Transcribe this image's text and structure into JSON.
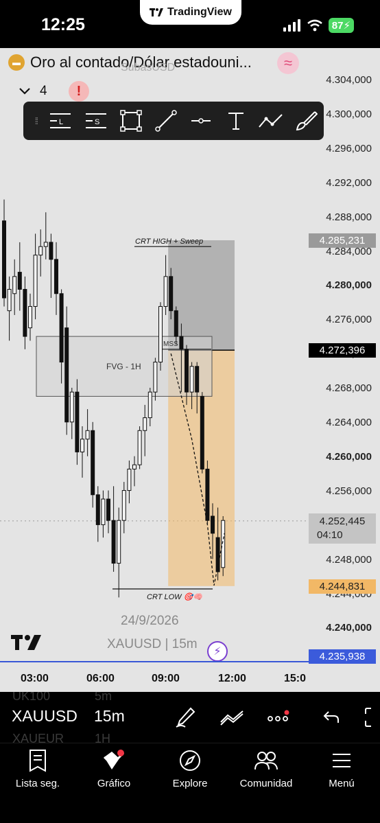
{
  "status_bar": {
    "time": "12:25",
    "app_pill": "TradingView",
    "battery": "87"
  },
  "header": {
    "symbol_title": "Oro al contado/Dólar estadouni...",
    "symbol_subtitle": "SubasUSD",
    "indicator_count": "4"
  },
  "price_axis": {
    "labels": [
      "4.304,000",
      "4.300,000",
      "4.296,000",
      "4.292,000",
      "4.288,000",
      "4.284,000",
      "4.280,000",
      "4.276,000",
      "4.272,000",
      "4.268,000",
      "4.264,000",
      "4.260,000",
      "4.256,000",
      "4.252,000",
      "4.248,000",
      "4.244,000",
      "4.240,000"
    ],
    "bold_labels": [
      "4.280,000",
      "4.260,000",
      "4.240,000"
    ]
  },
  "price_tags": {
    "upper": "4.285,231",
    "current": "4.272,396",
    "last_price": "4.252,445",
    "countdown": "04:10",
    "lower": "4.244,831",
    "blue": "4.235,938"
  },
  "annotations": {
    "crt_high": "CRT HIGH + Sweep",
    "fvg": "FVG - 1H",
    "mss": "MSS",
    "crt_low": "CRT LOW 🎯🧠"
  },
  "chart_info": {
    "date": "24/9/2026",
    "symbol_line": "XAUUSD | 15m"
  },
  "time_axis": [
    "03:00",
    "06:00",
    "09:00",
    "12:00",
    "15:0"
  ],
  "bottom_toolbar": {
    "symbol": "XAUUSD",
    "interval": "15m",
    "ghost_above_symbol": "UK100",
    "ghost_above_interval": "5m",
    "ghost_below_symbol": "XAUEUR",
    "ghost_below_interval": "1H"
  },
  "nav": [
    {
      "label": "Lista seg.",
      "icon": "watchlist-icon"
    },
    {
      "label": "Gráfico",
      "icon": "chart-icon"
    },
    {
      "label": "Explore",
      "icon": "compass-icon"
    },
    {
      "label": "Comunidad",
      "icon": "community-icon"
    },
    {
      "label": "Menú",
      "icon": "menu-icon"
    }
  ],
  "colors": {
    "background": "#e4e4e4",
    "orange_zone": "#f2b866",
    "grey_zone": "#a9a9a9",
    "blue_line": "#3857d6",
    "current_tag": "#000000",
    "lower_tag": "#f2b866",
    "blue_tag": "#3b5bdb"
  },
  "chart_data": {
    "type": "candlestick",
    "symbol": "XAUUSD",
    "interval": "15m",
    "ylim": [
      4236,
      4306
    ],
    "candles": [
      {
        "o": 4287.5,
        "h": 4290.0,
        "l": 4277.5,
        "c": 4278.5
      },
      {
        "o": 4277.0,
        "h": 4281.0,
        "l": 4273.5,
        "c": 4279.5
      },
      {
        "o": 4279.0,
        "h": 4283.0,
        "l": 4276.5,
        "c": 4281.0
      },
      {
        "o": 4281.5,
        "h": 4285.0,
        "l": 4277.0,
        "c": 4279.5
      },
      {
        "o": 4279.5,
        "h": 4281.0,
        "l": 4272.5,
        "c": 4274.0
      },
      {
        "o": 4275.0,
        "h": 4279.0,
        "l": 4273.5,
        "c": 4277.5
      },
      {
        "o": 4277.5,
        "h": 4286.0,
        "l": 4276.0,
        "c": 4283.5
      },
      {
        "o": 4283.5,
        "h": 4286.5,
        "l": 4281.0,
        "c": 4284.5
      },
      {
        "o": 4284.5,
        "h": 4288.5,
        "l": 4283.0,
        "c": 4285.0
      },
      {
        "o": 4285.0,
        "h": 4286.0,
        "l": 4278.5,
        "c": 4283.0
      },
      {
        "o": 4283.0,
        "h": 4285.0,
        "l": 4276.5,
        "c": 4279.0
      },
      {
        "o": 4279.0,
        "h": 4279.5,
        "l": 4268.5,
        "c": 4271.0
      },
      {
        "o": 4275.0,
        "h": 4277.5,
        "l": 4262.5,
        "c": 4264.0
      },
      {
        "o": 4264.0,
        "h": 4268.0,
        "l": 4262.0,
        "c": 4267.5
      },
      {
        "o": 4267.5,
        "h": 4269.0,
        "l": 4259.0,
        "c": 4260.5
      },
      {
        "o": 4260.5,
        "h": 4263.5,
        "l": 4257.5,
        "c": 4262.0
      },
      {
        "o": 4262.0,
        "h": 4265.5,
        "l": 4260.0,
        "c": 4263.0
      },
      {
        "o": 4263.0,
        "h": 4264.0,
        "l": 4254.0,
        "c": 4255.5
      },
      {
        "o": 4255.5,
        "h": 4256.5,
        "l": 4250.0,
        "c": 4252.0
      },
      {
        "o": 4252.0,
        "h": 4256.0,
        "l": 4250.5,
        "c": 4255.0
      },
      {
        "o": 4255.0,
        "h": 4256.0,
        "l": 4251.0,
        "c": 4252.5
      },
      {
        "o": 4252.5,
        "h": 4256.5,
        "l": 4246.5,
        "c": 4247.5
      },
      {
        "o": 4247.5,
        "h": 4254.0,
        "l": 4243.5,
        "c": 4252.5
      },
      {
        "o": 4252.5,
        "h": 4257.0,
        "l": 4251.0,
        "c": 4256.0
      },
      {
        "o": 4256.0,
        "h": 4259.5,
        "l": 4254.5,
        "c": 4258.5
      },
      {
        "o": 4258.5,
        "h": 4260.0,
        "l": 4256.5,
        "c": 4259.0
      },
      {
        "o": 4259.0,
        "h": 4263.5,
        "l": 4258.5,
        "c": 4263.0
      },
      {
        "o": 4263.0,
        "h": 4266.0,
        "l": 4260.0,
        "c": 4264.5
      },
      {
        "o": 4264.5,
        "h": 4268.0,
        "l": 4263.5,
        "c": 4267.5
      },
      {
        "o": 4267.5,
        "h": 4271.5,
        "l": 4266.5,
        "c": 4271.0
      },
      {
        "o": 4271.0,
        "h": 4278.0,
        "l": 4270.0,
        "c": 4277.5
      },
      {
        "o": 4277.5,
        "h": 4283.5,
        "l": 4276.5,
        "c": 4281.0
      },
      {
        "o": 4281.0,
        "h": 4282.0,
        "l": 4276.0,
        "c": 4277.0
      },
      {
        "o": 4277.0,
        "h": 4277.5,
        "l": 4273.0,
        "c": 4274.0
      },
      {
        "o": 4274.0,
        "h": 4275.5,
        "l": 4267.5,
        "c": 4272.5
      },
      {
        "o": 4272.5,
        "h": 4273.0,
        "l": 4266.0,
        "c": 4267.5
      },
      {
        "o": 4267.5,
        "h": 4271.0,
        "l": 4265.5,
        "c": 4270.5
      },
      {
        "o": 4270.5,
        "h": 4271.0,
        "l": 4265.0,
        "c": 4267.5
      },
      {
        "o": 4267.0,
        "h": 4267.5,
        "l": 4258.0,
        "c": 4258.5
      },
      {
        "o": 4258.5,
        "h": 4259.5,
        "l": 4252.0,
        "c": 4252.5
      },
      {
        "o": 4253.0,
        "h": 4254.5,
        "l": 4248.0,
        "c": 4251.0
      },
      {
        "o": 4250.5,
        "h": 4254.0,
        "l": 4245.5,
        "c": 4246.5
      },
      {
        "o": 4247.0,
        "h": 4253.0,
        "l": 4246.0,
        "c": 4252.5
      }
    ],
    "levels": {
      "crt_high": 4284.5,
      "crt_low": 4244.5,
      "mss": 4272.5,
      "current": 4272.396
    },
    "zones": {
      "fvg": {
        "top": 4274.0,
        "bottom": 4267.0
      },
      "stop": {
        "top": 4285.231,
        "bottom": 4272.396
      },
      "target": {
        "top": 4272.396,
        "bottom": 4244.831
      }
    }
  }
}
